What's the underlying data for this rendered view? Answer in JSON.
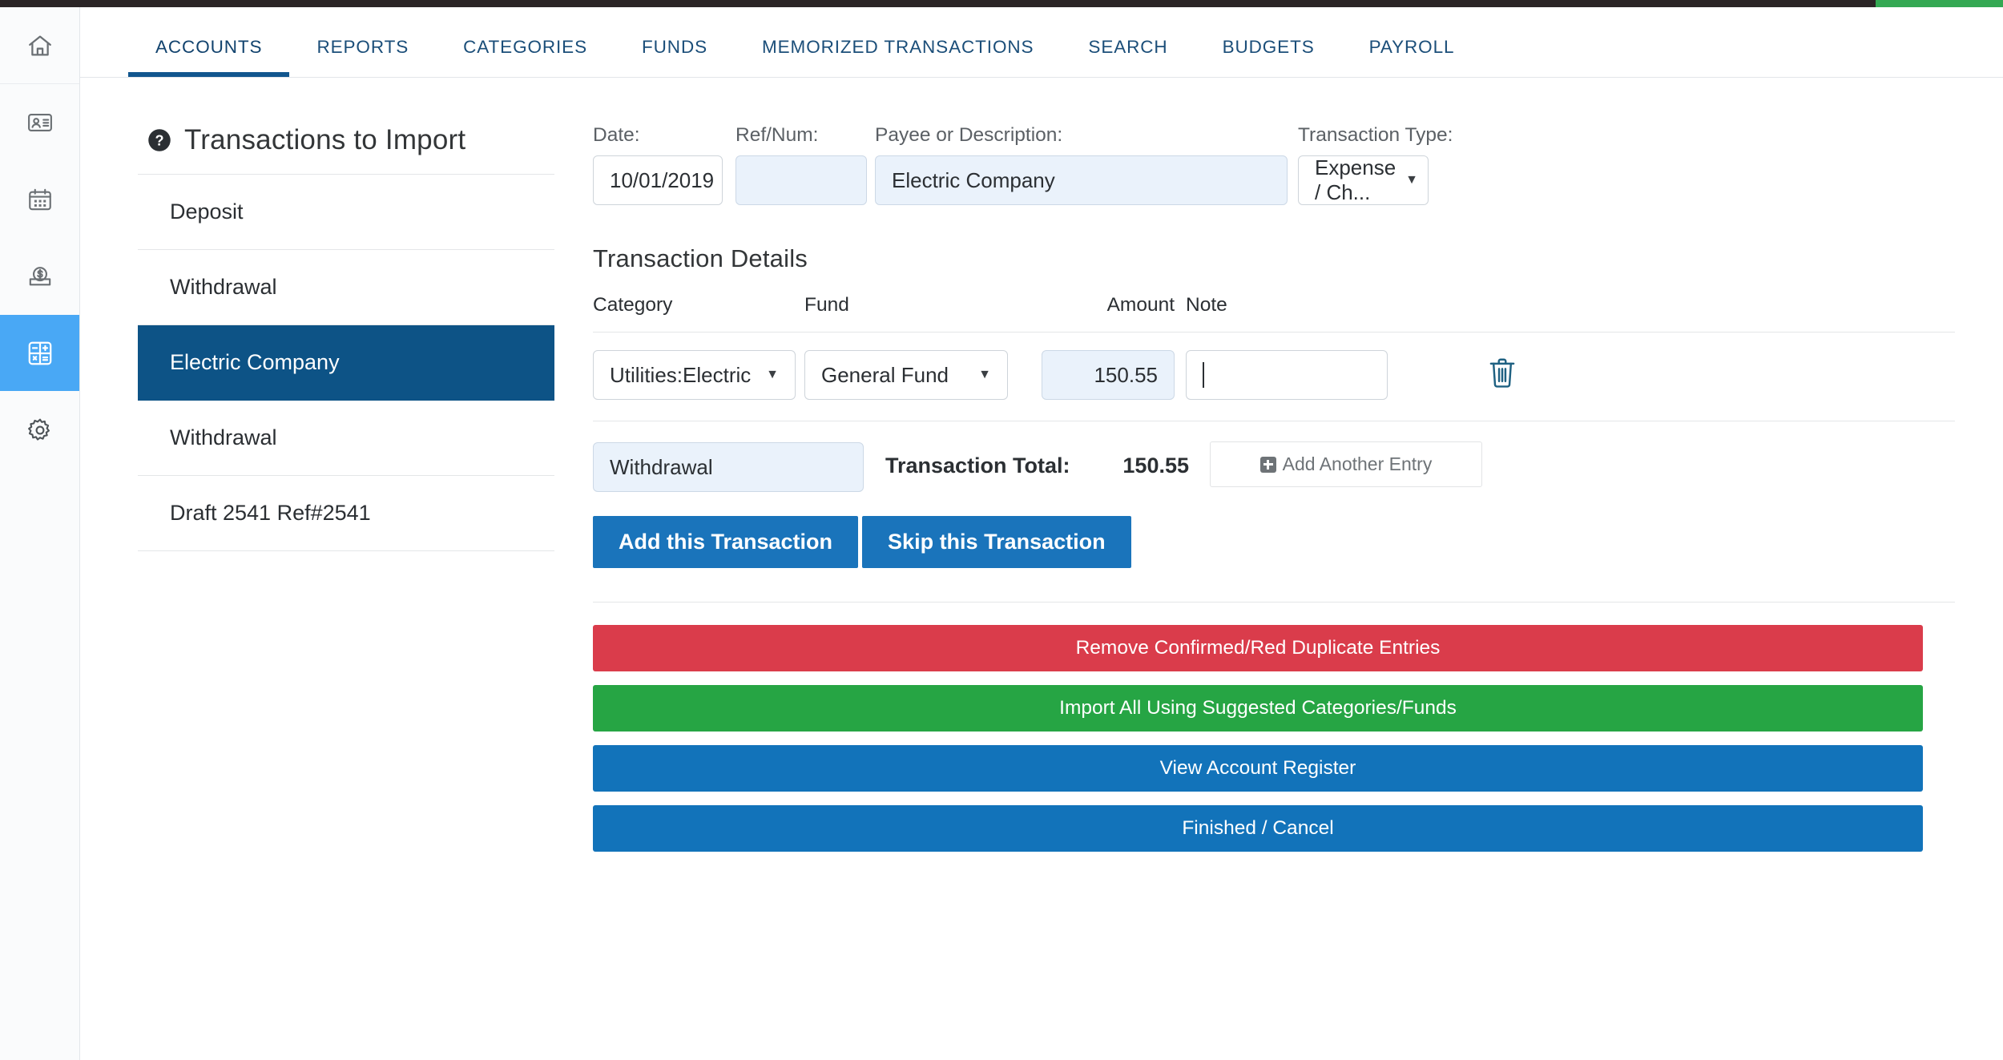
{
  "nav": {
    "tabs": [
      {
        "label": "ACCOUNTS",
        "active": true
      },
      {
        "label": "REPORTS",
        "active": false
      },
      {
        "label": "CATEGORIES",
        "active": false
      },
      {
        "label": "FUNDS",
        "active": false
      },
      {
        "label": "MEMORIZED TRANSACTIONS",
        "active": false
      },
      {
        "label": "SEARCH",
        "active": false
      },
      {
        "label": "BUDGETS",
        "active": false
      },
      {
        "label": "PAYROLL",
        "active": false
      }
    ]
  },
  "sidebar": {
    "items": [
      {
        "icon": "home-icon",
        "active": false
      },
      {
        "icon": "contact-card-icon",
        "active": false
      },
      {
        "icon": "calendar-icon",
        "active": false
      },
      {
        "icon": "money-deposit-icon",
        "active": false
      },
      {
        "icon": "calculator-icon",
        "active": true
      },
      {
        "icon": "gear-icon",
        "active": false
      }
    ]
  },
  "transactions_panel": {
    "help_icon": "help-circle-icon",
    "title": "Transactions to Import",
    "rows": [
      {
        "label": "Deposit",
        "selected": false
      },
      {
        "label": "Withdrawal",
        "selected": false
      },
      {
        "label": "Electric Company",
        "selected": true
      },
      {
        "label": "Withdrawal",
        "selected": false
      },
      {
        "label": "Draft 2541 Ref#2541",
        "selected": false
      }
    ]
  },
  "form": {
    "date": {
      "label": "Date:",
      "value": "10/01/2019"
    },
    "refnum": {
      "label": "Ref/Num:",
      "value": ""
    },
    "payee": {
      "label": "Payee or Description:",
      "value": "Electric Company"
    },
    "transaction_type": {
      "label": "Transaction Type:",
      "value": "Expense / Ch...",
      "caret": "▼"
    }
  },
  "details": {
    "title": "Transaction Details",
    "columns": {
      "category": "Category",
      "fund": "Fund",
      "amount": "Amount",
      "note": "Note"
    },
    "entries": [
      {
        "category": "Utilities:Electric",
        "fund": "General Fund",
        "amount": "150.55",
        "note": "",
        "delete_icon": "trash-icon"
      }
    ],
    "caret": "▼"
  },
  "totals": {
    "type_value": "Withdrawal",
    "total_label": "Transaction Total:",
    "total_value": "150.55",
    "add_entry_label": "Add Another Entry",
    "add_entry_icon": "plus-square-icon"
  },
  "actions": {
    "add_transaction": "Add this Transaction",
    "skip_transaction": "Skip this Transaction"
  },
  "bulk_actions": [
    {
      "label": "Remove Confirmed/Red Duplicate Entries",
      "color": "#da3c4b",
      "variant": "red"
    },
    {
      "label": "Import All Using Suggested Categories/Funds",
      "color": "#26a544",
      "variant": "green"
    },
    {
      "label": "View Account Register",
      "color": "#1273ba",
      "variant": "blue"
    },
    {
      "label": "Finished / Cancel",
      "color": "#1273ba",
      "variant": "blue"
    }
  ],
  "colors": {
    "nav_accent": "#11568e",
    "selected_row": "#0d5386",
    "rail_active": "#49a8f5",
    "primary_button": "#1a74bb",
    "top_bar_dark": "#2b2526",
    "top_bar_green": "#34a853"
  }
}
